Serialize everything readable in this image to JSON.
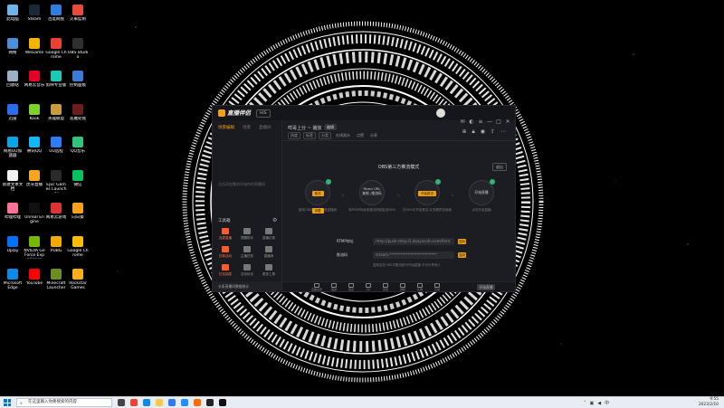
{
  "desktop": {
    "icons": [
      {
        "label": "此电脑",
        "color": "#6fb3e8"
      },
      {
        "label": "Steam",
        "color": "#1b2838"
      },
      {
        "label": "百度网盘",
        "color": "#2f7de1"
      },
      {
        "label": "火車監制",
        "color": "#e84b3c"
      },
      {
        "label": "网络",
        "color": "#4a90d9"
      },
      {
        "label": "WeGame",
        "color": "#f5b400"
      },
      {
        "label": "Google Chrome",
        "color": "#ea4335"
      },
      {
        "label": "OBS Studio",
        "color": "#302e31"
      },
      {
        "label": "回收站",
        "color": "#9ab0c4"
      },
      {
        "label": "网易云音乐",
        "color": "#e60026"
      },
      {
        "label": "剪映专业版",
        "color": "#1bc9b7"
      },
      {
        "label": "控制面板",
        "color": "#3a7bd5"
      },
      {
        "label": "迅雷",
        "color": "#2a6ef0"
      },
      {
        "label": "Kook",
        "color": "#7bd22f"
      },
      {
        "label": "英雄联盟",
        "color": "#c89b3c"
      },
      {
        "label": "恶魔轮盘",
        "color": "#6b1d1d"
      },
      {
        "label": "网易UU加速器",
        "color": "#0aa4e8"
      },
      {
        "label": "腾讯QQ",
        "color": "#12b7f5"
      },
      {
        "label": "UU远程",
        "color": "#2d7cf6"
      },
      {
        "label": "QQ音乐",
        "color": "#31c27c"
      },
      {
        "label": "新建文本文档",
        "color": "#f2f2f2"
      },
      {
        "label": "虎牙直播",
        "color": "#f5a623"
      },
      {
        "label": "Epic Games Launcher",
        "color": "#2a2a2a"
      },
      {
        "label": "微信",
        "color": "#07c160"
      },
      {
        "label": "哔哩哔哩",
        "color": "#fb7299"
      },
      {
        "label": "Unreal Engine",
        "color": "#111"
      },
      {
        "label": "网易云游戏",
        "color": "#d33"
      },
      {
        "label": "向日葵",
        "color": "#f8a11d"
      },
      {
        "label": "Uplay",
        "color": "#0070ff"
      },
      {
        "label": "NVIDIA GeForce Experience",
        "color": "#76b900"
      },
      {
        "label": "PUBG",
        "color": "#f2a900"
      },
      {
        "label": "Google Chrome",
        "color": "#fbbc05"
      },
      {
        "label": "Microsoft Edge",
        "color": "#0c8ae5"
      },
      {
        "label": "YouTube",
        "color": "#ff0000"
      },
      {
        "label": "Minecraft Launcher",
        "color": "#6b8e23"
      },
      {
        "label": "Rockstar Games",
        "color": "#fcaf17"
      }
    ]
  },
  "app": {
    "logo_text": "直播伴侣",
    "version": "HIS",
    "left_tabs": [
      "场景编辑",
      "场景",
      "直播间"
    ],
    "empty_message": "点击添加素材开始你的直播间",
    "tools_title": "工具箱",
    "tools": [
      {
        "label": "连麦直播",
        "color": "#ff5a2c",
        "highlight": true
      },
      {
        "label": "提醒助手",
        "color": "#777",
        "highlight": false
      },
      {
        "label": "直播记录",
        "color": "#777",
        "highlight": false
      },
      {
        "label": "拉新活动",
        "color": "#ff5a2c",
        "highlight": true
      },
      {
        "label": "主播任务",
        "color": "#777",
        "highlight": false
      },
      {
        "label": "直播间",
        "color": "#777",
        "highlight": false
      },
      {
        "label": "红包抽奖",
        "color": "#ff5a2c",
        "highlight": true
      },
      {
        "label": "互动玩法",
        "color": "#777",
        "highlight": false
      },
      {
        "label": "更多工具",
        "color": "#777",
        "highlight": false
      }
    ],
    "left_bottom_text": "头条直播间数据统计",
    "room": {
      "title": "咩哥上分 ~ 播放",
      "badge": "编辑",
      "tags": [
        "热度",
        "标签",
        "分类"
      ],
      "plain_tags": [
        "在线观众",
        "点赞",
        "分享"
      ]
    },
    "mode_title": "OBS第三方推流模式",
    "exit_label": "退出",
    "steps": [
      {
        "top": "",
        "button": "",
        "buttons": [
          "推流",
          "设置"
        ],
        "caption": "使用OBS推流到抖音直播间"
      },
      {
        "top": "Rtmp URL",
        "sub": "复制 /推流码",
        "caption": "将RTMP地址和推流码粘贴到OBS"
      },
      {
        "top": "",
        "buttons": [
          "开始推流"
        ],
        "caption": "在OBS中开始推流 并查看预览画面"
      },
      {
        "top": "开始直播",
        "caption": "点击开始直播"
      }
    ],
    "form": {
      "rtmp_label": "RTMP地址",
      "rtmp_value": "rtmp://push-rtmp-l1.douyincdn.com/third",
      "key_label": "推流码",
      "key_value": "stream-**************************",
      "copy_label": "复制"
    },
    "tip": "复制后在OBS中推流即可开始直播 不可分享他人",
    "bottom_tools": [
      "直播设置",
      "美颜",
      "连麦",
      "PK",
      "音效",
      "弹幕",
      "礼物",
      "互动"
    ],
    "start_label": "开始直播"
  },
  "taskbar": {
    "search_placeholder": "在这里输入你要搜索的内容",
    "apps": [
      {
        "name": "task-view-icon",
        "color": "#444"
      },
      {
        "name": "chrome-icon",
        "color": "#ea4335"
      },
      {
        "name": "edge-icon",
        "color": "#0c8ae5"
      },
      {
        "name": "explorer-icon",
        "color": "#f7c948"
      },
      {
        "name": "store-icon",
        "color": "#2d7cf6"
      },
      {
        "name": "mail-icon",
        "color": "#1e90ff"
      },
      {
        "name": "photos-icon",
        "color": "#ff6b00"
      },
      {
        "name": "obs-icon",
        "color": "#222"
      },
      {
        "name": "live-companion-icon",
        "color": "#111"
      }
    ],
    "time": "9:55",
    "date": "2023/2/10"
  }
}
